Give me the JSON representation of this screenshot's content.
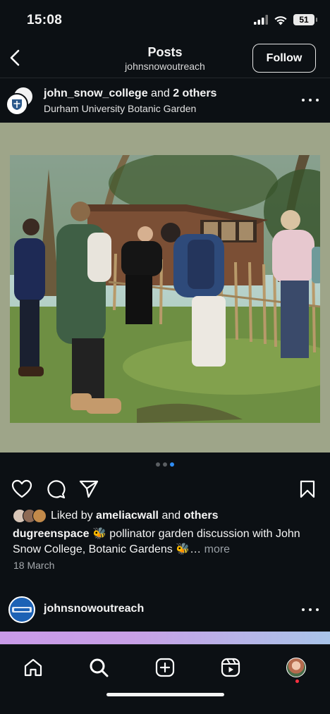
{
  "status_bar": {
    "time": "15:08",
    "battery": "51",
    "icons": [
      "signal-icon",
      "wifi-icon",
      "battery-icon"
    ]
  },
  "nav": {
    "title": "Posts",
    "subtitle": "johnsnowoutreach",
    "follow_label": "Follow",
    "back_icon": "chevron-left-icon"
  },
  "post": {
    "author": "john_snow_college",
    "author_join": "and",
    "coauthors": "2 others",
    "location": "Durham University Botanic Garden",
    "carousel": {
      "count": 3,
      "active_index": 2
    },
    "liked_by_prefix": "Liked by",
    "liked_by_user": "ameliacwall",
    "liked_by_join": "and",
    "liked_by_others": "others",
    "caption_user": "dugreenspace",
    "caption_text": "🐝 pollinator garden discussion with John Snow College, Botanic Gardens 🐝…",
    "caption_more": "more",
    "date": "18 March"
  },
  "next_post": {
    "author": "johnsnowoutreach"
  },
  "tab_bar": {
    "items": [
      "home-icon",
      "search-icon",
      "create-icon",
      "reels-icon",
      "profile-avatar"
    ]
  },
  "colors": {
    "background": "#0c1014",
    "accent": "#2f8cf3",
    "media_background": "#9ea589",
    "notification": "#ff3040"
  }
}
